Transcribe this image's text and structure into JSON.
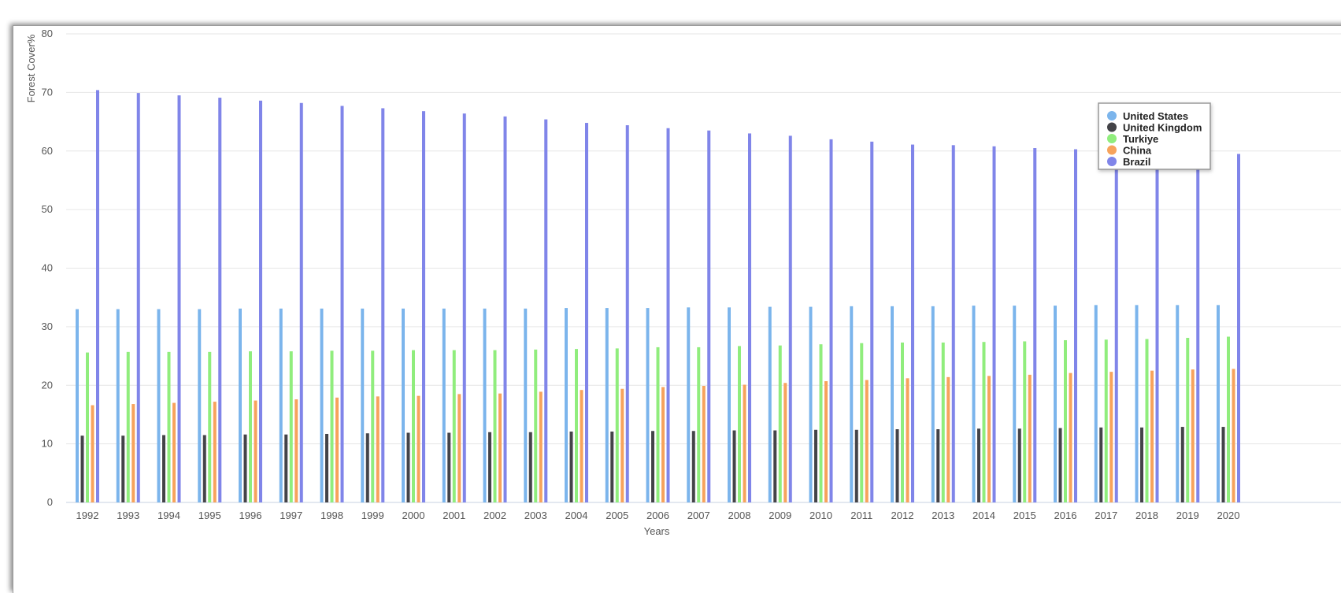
{
  "chart_data": {
    "type": "bar",
    "title": "",
    "xlabel": "Years",
    "ylabel": "Forest Cover%",
    "ylim": [
      0,
      80
    ],
    "yticks": [
      0,
      10,
      20,
      30,
      40,
      50,
      60,
      70,
      80
    ],
    "grid": true,
    "legend_position": "top-right",
    "categories": [
      "1992",
      "1993",
      "1994",
      "1995",
      "1996",
      "1997",
      "1998",
      "1999",
      "2000",
      "2001",
      "2002",
      "2003",
      "2004",
      "2005",
      "2006",
      "2007",
      "2008",
      "2009",
      "2010",
      "2011",
      "2012",
      "2013",
      "2014",
      "2015",
      "2016",
      "2017",
      "2018",
      "2019",
      "2020"
    ],
    "series": [
      {
        "name": "United States",
        "color": "#7cb5ec",
        "values": [
          33.0,
          33.0,
          33.0,
          33.0,
          33.1,
          33.1,
          33.1,
          33.1,
          33.1,
          33.1,
          33.1,
          33.1,
          33.2,
          33.2,
          33.2,
          33.3,
          33.3,
          33.4,
          33.4,
          33.5,
          33.5,
          33.5,
          33.6,
          33.6,
          33.6,
          33.7,
          33.7,
          33.7,
          33.7
        ]
      },
      {
        "name": "United Kingdom",
        "color": "#434348",
        "values": [
          11.4,
          11.4,
          11.5,
          11.5,
          11.6,
          11.6,
          11.7,
          11.8,
          11.9,
          11.9,
          12.0,
          12.0,
          12.1,
          12.1,
          12.2,
          12.2,
          12.3,
          12.3,
          12.4,
          12.4,
          12.5,
          12.5,
          12.6,
          12.6,
          12.7,
          12.8,
          12.8,
          12.9,
          12.9
        ]
      },
      {
        "name": "Turkiye",
        "color": "#90ed7d",
        "values": [
          25.6,
          25.7,
          25.7,
          25.7,
          25.8,
          25.8,
          25.9,
          25.9,
          26.0,
          26.0,
          26.0,
          26.1,
          26.2,
          26.3,
          26.5,
          26.5,
          26.7,
          26.8,
          27.0,
          27.2,
          27.3,
          27.3,
          27.4,
          27.5,
          27.7,
          27.8,
          27.9,
          28.1,
          28.3
        ]
      },
      {
        "name": "China",
        "color": "#f7a35c",
        "values": [
          16.6,
          16.8,
          17.0,
          17.2,
          17.4,
          17.6,
          17.9,
          18.1,
          18.2,
          18.5,
          18.6,
          18.9,
          19.2,
          19.4,
          19.7,
          19.9,
          20.1,
          20.4,
          20.7,
          20.9,
          21.2,
          21.4,
          21.6,
          21.8,
          22.1,
          22.3,
          22.5,
          22.7,
          22.8
        ]
      },
      {
        "name": "Brazil",
        "color": "#8085e9",
        "values": [
          70.4,
          69.9,
          69.5,
          69.1,
          68.6,
          68.2,
          67.7,
          67.3,
          66.8,
          66.4,
          65.9,
          65.4,
          64.8,
          64.4,
          63.9,
          63.5,
          63.0,
          62.6,
          62.0,
          61.6,
          61.1,
          61.0,
          60.8,
          60.5,
          60.3,
          60.0,
          59.8,
          59.6,
          59.5
        ]
      }
    ]
  }
}
